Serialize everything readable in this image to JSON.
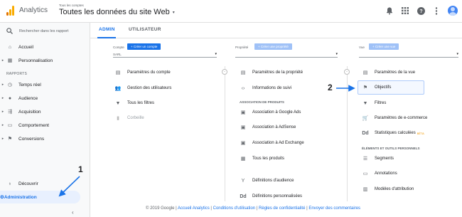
{
  "header": {
    "app_name": "Analytics",
    "breadcrumb": "Tous les comptes",
    "account_name": "Toutes les données du site Web",
    "caret": "▾"
  },
  "sidebar": {
    "search_placeholder": "Rechercher dans les rapport",
    "home": "Accueil",
    "customization": "Personnalisation",
    "reports_label": "RAPPORTS",
    "items": [
      "Temps réel",
      "Audience",
      "Acquisition",
      "Comportement",
      "Conversions"
    ],
    "discover": "Découvrir",
    "admin": "Administration"
  },
  "tabs": {
    "admin": "ADMIN",
    "user": "UTILISATEUR"
  },
  "account_col": {
    "label": "Compte",
    "create": "+ Créer un compte",
    "selected": "SARL",
    "items": [
      "Paramètres du compte",
      "Gestion des utilisateurs",
      "Tous les filtres",
      "Corbeille"
    ]
  },
  "property_col": {
    "label": "Propriété",
    "create": "+ Créer une propriété",
    "selected": "",
    "items": [
      "Paramètres de la propriété",
      "Informations de suivi"
    ],
    "products_label": "ASSOCIATION DE PRODUITS",
    "products": [
      "Association à Google Ads",
      "Association à AdSense",
      "Association à Ad Exchange",
      "Tous les produits"
    ],
    "more": [
      "Définitions d'audience",
      "Définitions personnalisées"
    ]
  },
  "view_col": {
    "label": "Vue",
    "create": "+ Créer une vue",
    "selected": "",
    "items": [
      "Paramètres de la vue",
      "Objectifs",
      "Filtres",
      "Paramètres de e-commerce",
      "Statistiques calculées"
    ],
    "beta": "BÊTA",
    "personal_label": "ÉLÉMENTS ET OUTILS PERSONNELS",
    "personal": [
      "Segments",
      "Annotations",
      "Modèles d'attribution"
    ]
  },
  "annotations": {
    "one": "1",
    "two": "2"
  },
  "footer": {
    "copyright": "© 2019 Google |",
    "links": [
      "Accueil Analytics",
      "Conditions d'utilisation",
      "Règles de confidentialité",
      "Envoyer des commentaires"
    ]
  },
  "colors": {
    "accent": "#1a73e8",
    "disabled_button": "#9fc1f7",
    "arrow": "#1a73e8"
  }
}
